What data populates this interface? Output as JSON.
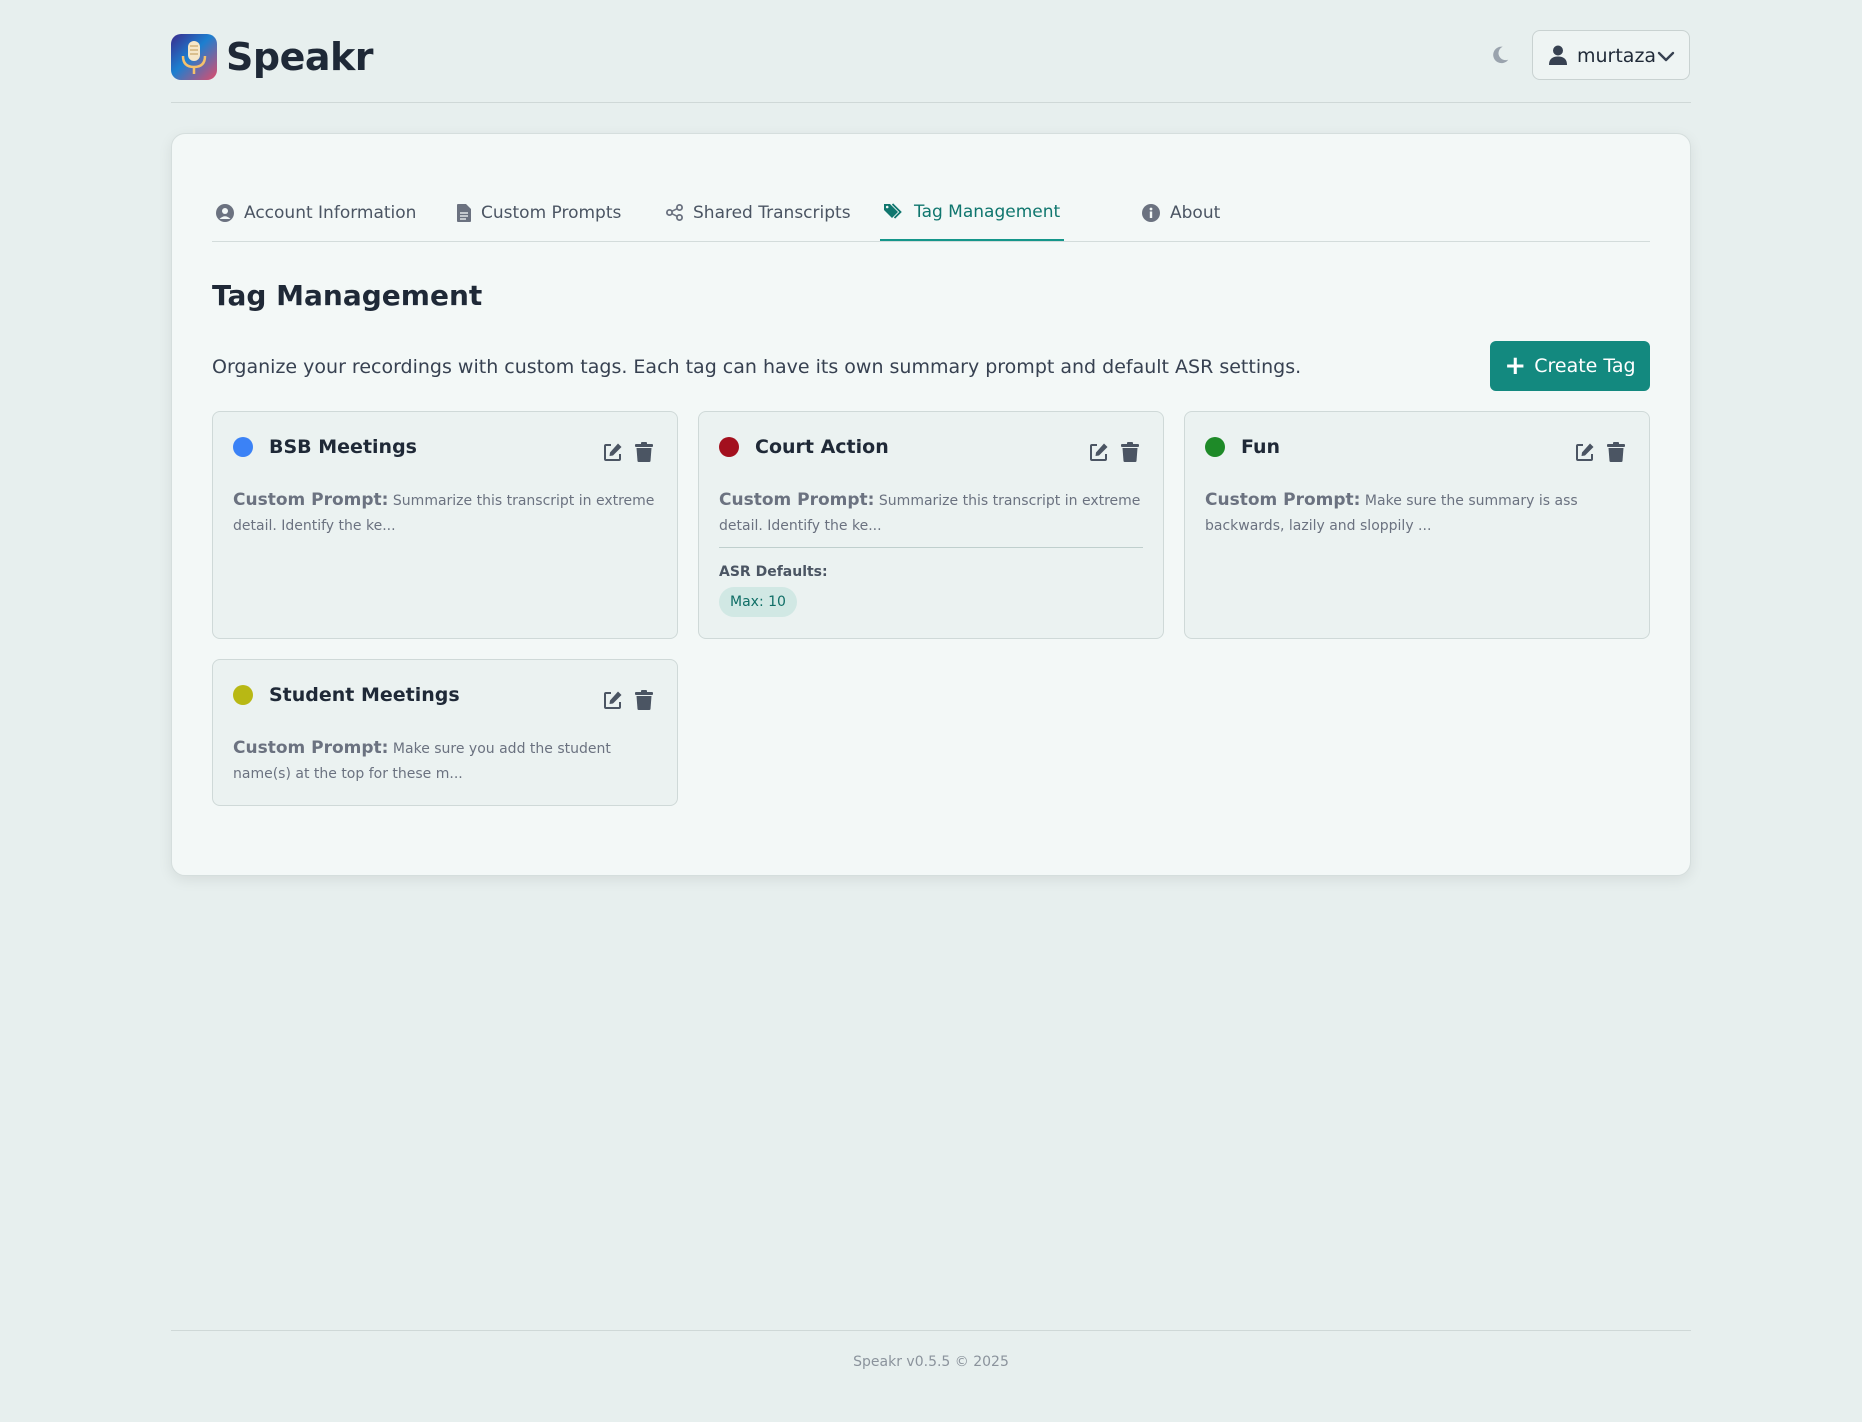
{
  "app": {
    "name": "Speakr",
    "icons": {
      "logo": "microphone-logo-icon",
      "theme": "moon-icon",
      "user": "user-icon",
      "dropdown": "chevron-down-icon"
    }
  },
  "header": {
    "username": "murtaza"
  },
  "tabs": [
    {
      "label": "Account Information",
      "icon": "user-circle-icon"
    },
    {
      "label": "Custom Prompts",
      "icon": "document-icon"
    },
    {
      "label": "Shared Transcripts",
      "icon": "share-icon"
    },
    {
      "label": "Tag Management",
      "icon": "tags-icon",
      "active": true
    },
    {
      "label": "About",
      "icon": "info-circle-icon"
    }
  ],
  "main": {
    "title": "Tag Management",
    "description": "Organize your recordings with custom tags. Each tag can have its own summary prompt and default ASR settings.",
    "create_button": "Create Tag",
    "create_button_icon": "+"
  },
  "tags": [
    {
      "name": "BSB Meetings",
      "color": "#3b82f6",
      "prompt_label": "Custom Prompt:",
      "prompt": "Summarize this transcript in extreme detail. Identify the ke..."
    },
    {
      "name": "Court Action",
      "color": "#a3101e",
      "prompt_label": "Custom Prompt:",
      "prompt": "Summarize this transcript in extreme detail. Identify the ke...",
      "asr_label": "ASR Defaults:",
      "asr_chip": "Max: 10"
    },
    {
      "name": "Fun",
      "color": "#1e8a28",
      "prompt_label": "Custom Prompt:",
      "prompt": "Make sure the summary is ass backwards, lazily and sloppily ..."
    },
    {
      "name": "Student Meetings",
      "color": "#b8b814",
      "prompt_label": "Custom Prompt:",
      "prompt": "Make sure you add the student name(s) at the top for these m..."
    }
  ],
  "footer": {
    "text": "Speakr v0.5.5 © 2025"
  },
  "colors": {
    "accent": "#13897f",
    "background": "#e7efee",
    "card": "#f3f8f7"
  }
}
